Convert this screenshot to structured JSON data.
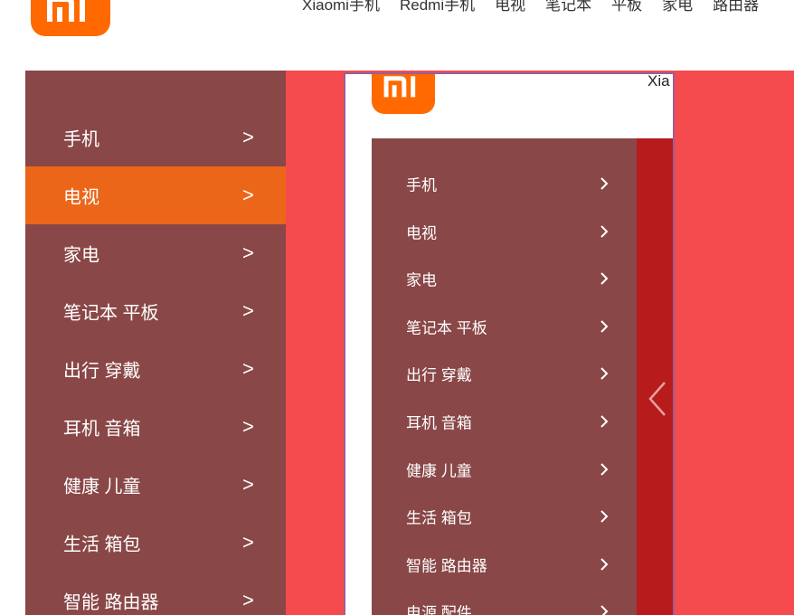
{
  "header": {
    "logo_icon": "mi-logo-icon",
    "nav": [
      "Xiaomi手机",
      "Redmi手机",
      "电视",
      "笔记本",
      "平板",
      "家电",
      "路由器"
    ]
  },
  "big_menu": {
    "arrow": ">",
    "items": [
      {
        "label": "手机"
      },
      {
        "label": "电视",
        "active": true
      },
      {
        "label": "家电"
      },
      {
        "label": "笔记本 平板"
      },
      {
        "label": "出行 穿戴"
      },
      {
        "label": "耳机 音箱"
      },
      {
        "label": "健康 儿童"
      },
      {
        "label": "生活 箱包"
      },
      {
        "label": "智能 路由器"
      }
    ]
  },
  "nested": {
    "title": "Xia",
    "menu": [
      {
        "label": "手机"
      },
      {
        "label": "电视"
      },
      {
        "label": "家电"
      },
      {
        "label": "笔记本 平板"
      },
      {
        "label": "出行 穿戴"
      },
      {
        "label": "耳机 音箱"
      },
      {
        "label": "健康 儿童"
      },
      {
        "label": "生活 箱包"
      },
      {
        "label": "智能 路由器"
      },
      {
        "label": "电源 配件"
      }
    ]
  },
  "colors": {
    "brand_orange": "#ff6900",
    "menu_bg": "#8a4747",
    "active_item": "#eb6619",
    "panel_red": "#f54a4e",
    "carousel_red": "#b71b1b"
  }
}
